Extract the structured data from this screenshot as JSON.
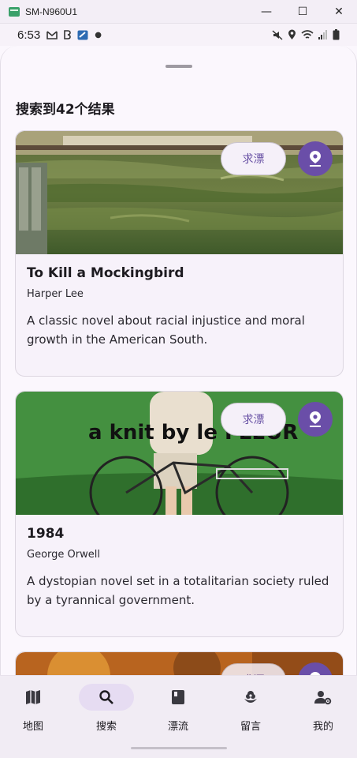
{
  "window": {
    "title": "SM-N960U1",
    "minimize": "—",
    "maximize": "☐",
    "close": "✕"
  },
  "status_bar": {
    "time": "6:53",
    "left_icons": [
      "gmail-icon",
      "b-icon",
      "app-icon",
      "dot"
    ],
    "right_icons": [
      "mute-icon",
      "location-icon",
      "wifi-icon",
      "signal-icon",
      "battery-icon"
    ]
  },
  "results": {
    "title": "搜索到42个结果"
  },
  "cards": [
    {
      "title": "To Kill a Mockingbird",
      "author": "Harper Lee",
      "description": "A classic novel about racial injustice and moral growth in the American South.",
      "action_label": "求漂"
    },
    {
      "title": "1984",
      "author": "George Orwell",
      "description": "A dystopian novel set in a totalitarian society ruled by a tyrannical government.",
      "image_text": "a knit by le FLEUR",
      "action_label": "求漂"
    },
    {
      "action_label": "求漂"
    }
  ],
  "nav": [
    {
      "label": "地图",
      "icon": "map-icon",
      "active": false
    },
    {
      "label": "搜索",
      "icon": "search-icon",
      "active": true
    },
    {
      "label": "漂流",
      "icon": "book-icon",
      "active": false
    },
    {
      "label": "留言",
      "icon": "flower-icon",
      "active": false
    },
    {
      "label": "我的",
      "icon": "profile-settings-icon",
      "active": false
    }
  ],
  "colors": {
    "accent": "#6a4ea8",
    "nav_active_bg": "#e6dcf2",
    "surface": "#fbf7fd"
  }
}
